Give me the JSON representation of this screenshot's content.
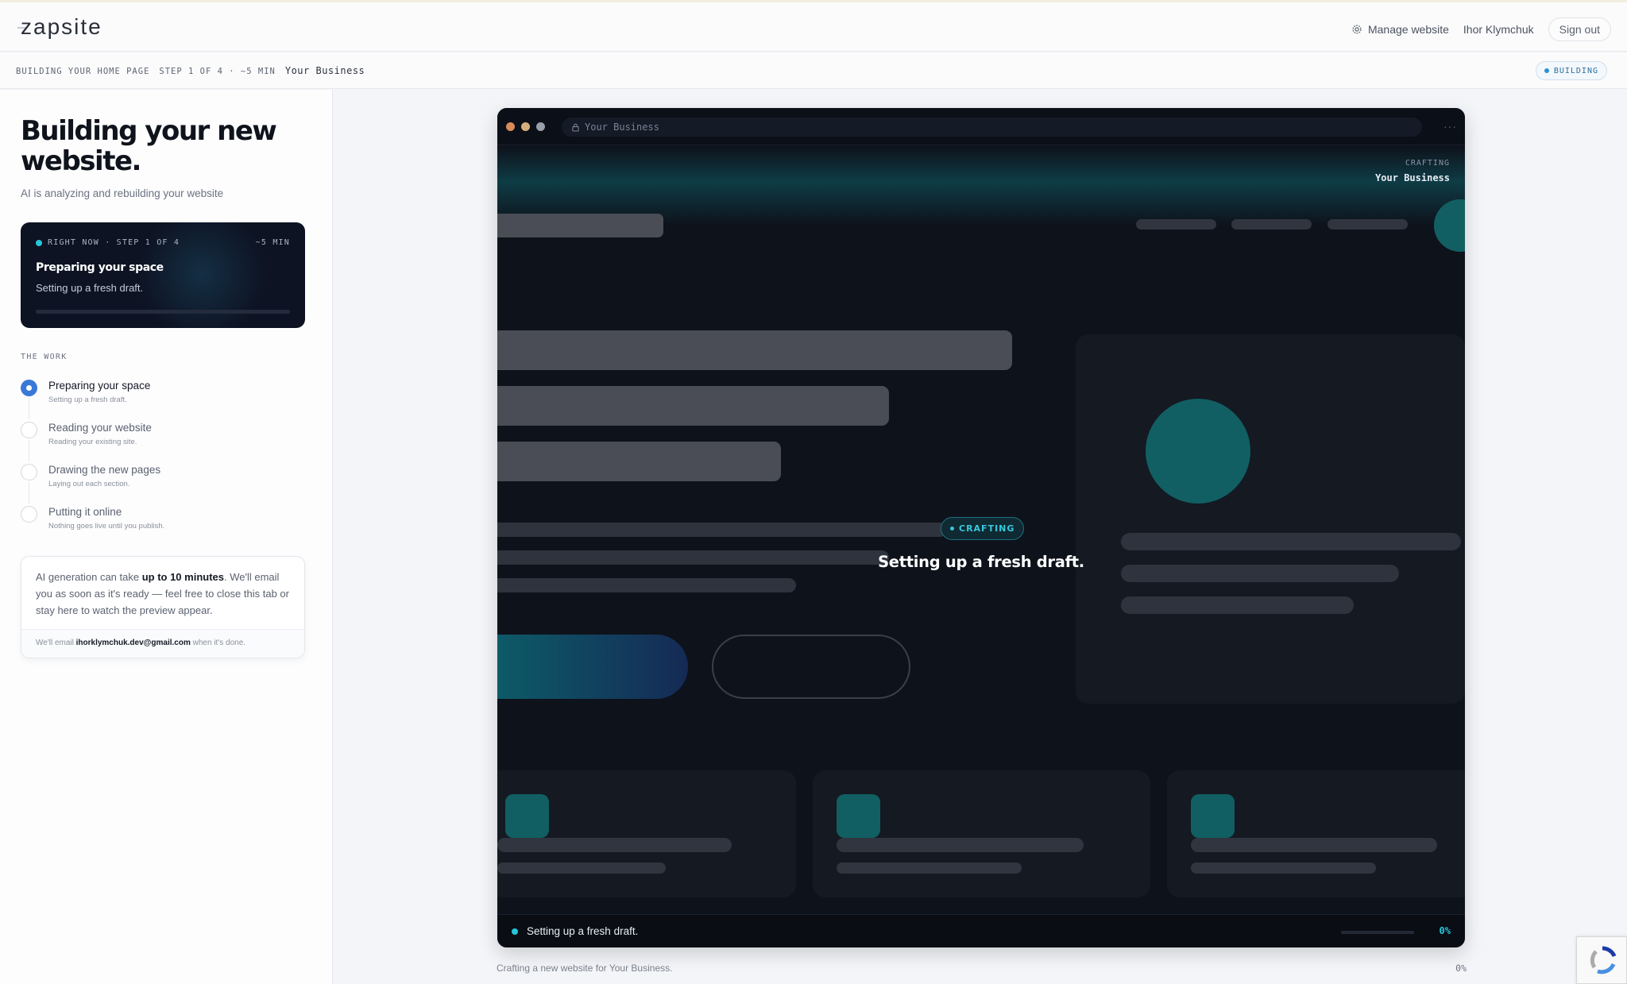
{
  "header": {
    "logo": "zapsite",
    "manage_label": "Manage website",
    "user_name": "Ihor Klymchuk",
    "signout_label": "Sign out"
  },
  "subbar": {
    "crumb": "BUILDING YOUR HOME PAGE",
    "step": "STEP 1 OF 4 · ~5 MIN",
    "business": "Your Business",
    "status": "BUILDING"
  },
  "left": {
    "title": "Building your new website.",
    "subtitle": "AI is analyzing and rebuilding your website",
    "now": {
      "meta": "RIGHT NOW · STEP 1 OF 4",
      "eta": "~5 MIN",
      "title": "Preparing your space",
      "desc": "Setting up a fresh draft.",
      "progress": 0
    },
    "work_label": "THE WORK",
    "steps": [
      {
        "name": "Preparing your space",
        "desc": "Setting up a fresh draft.",
        "state": "active"
      },
      {
        "name": "Reading your website",
        "desc": "Reading your existing site.",
        "state": "pending"
      },
      {
        "name": "Drawing the new pages",
        "desc": "Laying out each section.",
        "state": "pending"
      },
      {
        "name": "Putting it online",
        "desc": "Nothing goes live until you publish.",
        "state": "pending"
      }
    ],
    "info": {
      "pre": "AI generation can take ",
      "bold": "up to 10 minutes",
      "post": ". We'll email you as soon as it's ready — feel free to close this tab or stay here to watch the preview appear.",
      "email_pre": "We'll email ",
      "email": "ihorklymchuk.dev@gmail.com",
      "email_post": " when it's done."
    }
  },
  "preview": {
    "url": "Your Business",
    "more": "···",
    "crafting_label": "CRAFTING",
    "crafting_business": "Your Business",
    "badge": "CRAFTING",
    "center_message": "Setting up a fresh draft.",
    "status_message": "Setting up a fresh draft.",
    "percent": "0%",
    "caption": "Crafting a new website for Your Business.",
    "caption_percent": "0%"
  },
  "colors": {
    "accent": "#3a78d8",
    "teal": "#26c6da",
    "dark": "#0e121b"
  }
}
